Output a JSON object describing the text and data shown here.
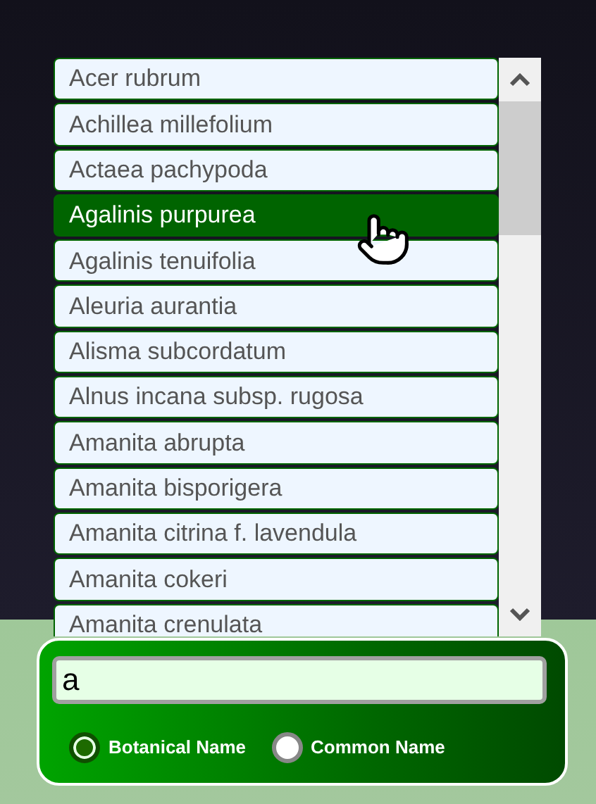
{
  "list": {
    "items": [
      {
        "label": "Acer rubrum",
        "selected": false
      },
      {
        "label": "Achillea millefolium",
        "selected": false
      },
      {
        "label": "Actaea pachypoda",
        "selected": false
      },
      {
        "label": "Agalinis purpurea",
        "selected": true
      },
      {
        "label": "Agalinis tenuifolia",
        "selected": false
      },
      {
        "label": "Aleuria aurantia",
        "selected": false
      },
      {
        "label": "Alisma subcordatum",
        "selected": false
      },
      {
        "label": "Alnus incana subsp. rugosa",
        "selected": false
      },
      {
        "label": "Amanita abrupta",
        "selected": false
      },
      {
        "label": "Amanita bisporigera",
        "selected": false
      },
      {
        "label": "Amanita citrina f. lavendula",
        "selected": false
      },
      {
        "label": "Amanita cokeri",
        "selected": false
      },
      {
        "label": "Amanita crenulata",
        "selected": false
      }
    ]
  },
  "search": {
    "value": "a"
  },
  "name_options": [
    {
      "label": "Botanical Name",
      "selected": true
    },
    {
      "label": "Common Name",
      "selected": false
    }
  ]
}
